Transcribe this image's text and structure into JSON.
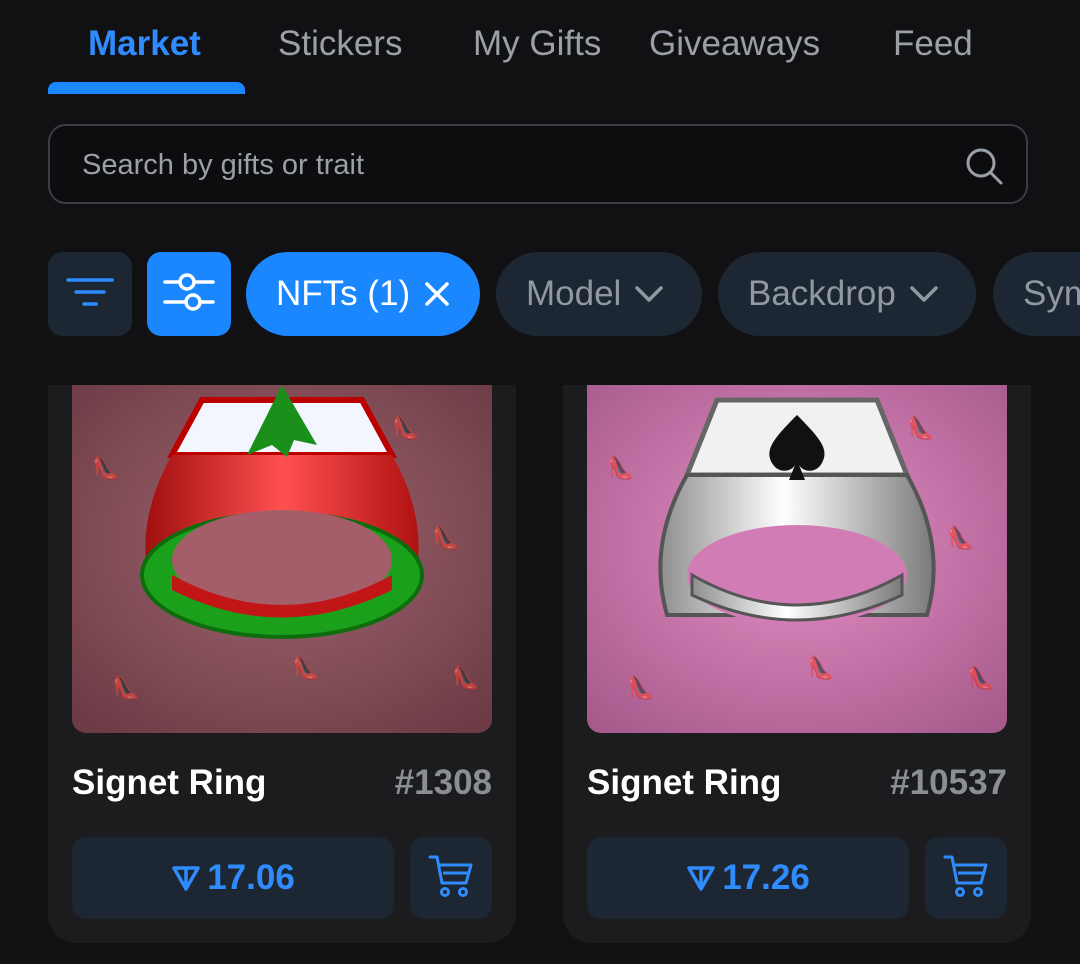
{
  "tabs": [
    {
      "label": "Market",
      "active": true
    },
    {
      "label": "Stickers",
      "active": false
    },
    {
      "label": "My Gifts",
      "active": false
    },
    {
      "label": "Giveaways",
      "active": false
    },
    {
      "label": "Feed",
      "active": false
    }
  ],
  "search": {
    "placeholder": "Search by gifts or trait",
    "value": "",
    "icon": "search-icon"
  },
  "filters": {
    "sort_icon": "sort-icon",
    "adjust_icon": "sliders-icon",
    "chips": [
      {
        "label": "NFTs (1)",
        "icon": "close-icon",
        "active": true
      },
      {
        "label": "Model",
        "icon": "chevron-down-icon",
        "active": false
      },
      {
        "label": "Backdrop",
        "icon": "chevron-down-icon",
        "active": false
      },
      {
        "label": "Symbol",
        "icon": "chevron-down-icon",
        "active": false
      }
    ]
  },
  "cards": [
    {
      "name": "Signet Ring",
      "number": "#1308",
      "price": "17.06",
      "currency_icon": "ton-icon",
      "cart_icon": "cart-icon",
      "backdrop_color": "#7e4a53",
      "ring_colors": [
        "#cc1b1b",
        "#1e9e1e"
      ]
    },
    {
      "name": "Signet Ring",
      "number": "#10537",
      "price": "17.26",
      "currency_icon": "ton-icon",
      "cart_icon": "cart-icon",
      "backdrop_color": "#c06aa2",
      "ring_colors": [
        "#c9c9c9",
        "#7a7a7a"
      ]
    }
  ],
  "colors": {
    "accent": "#1a87ff",
    "background": "#111113",
    "card": "#1c1c1f",
    "button": "#1d2733"
  }
}
